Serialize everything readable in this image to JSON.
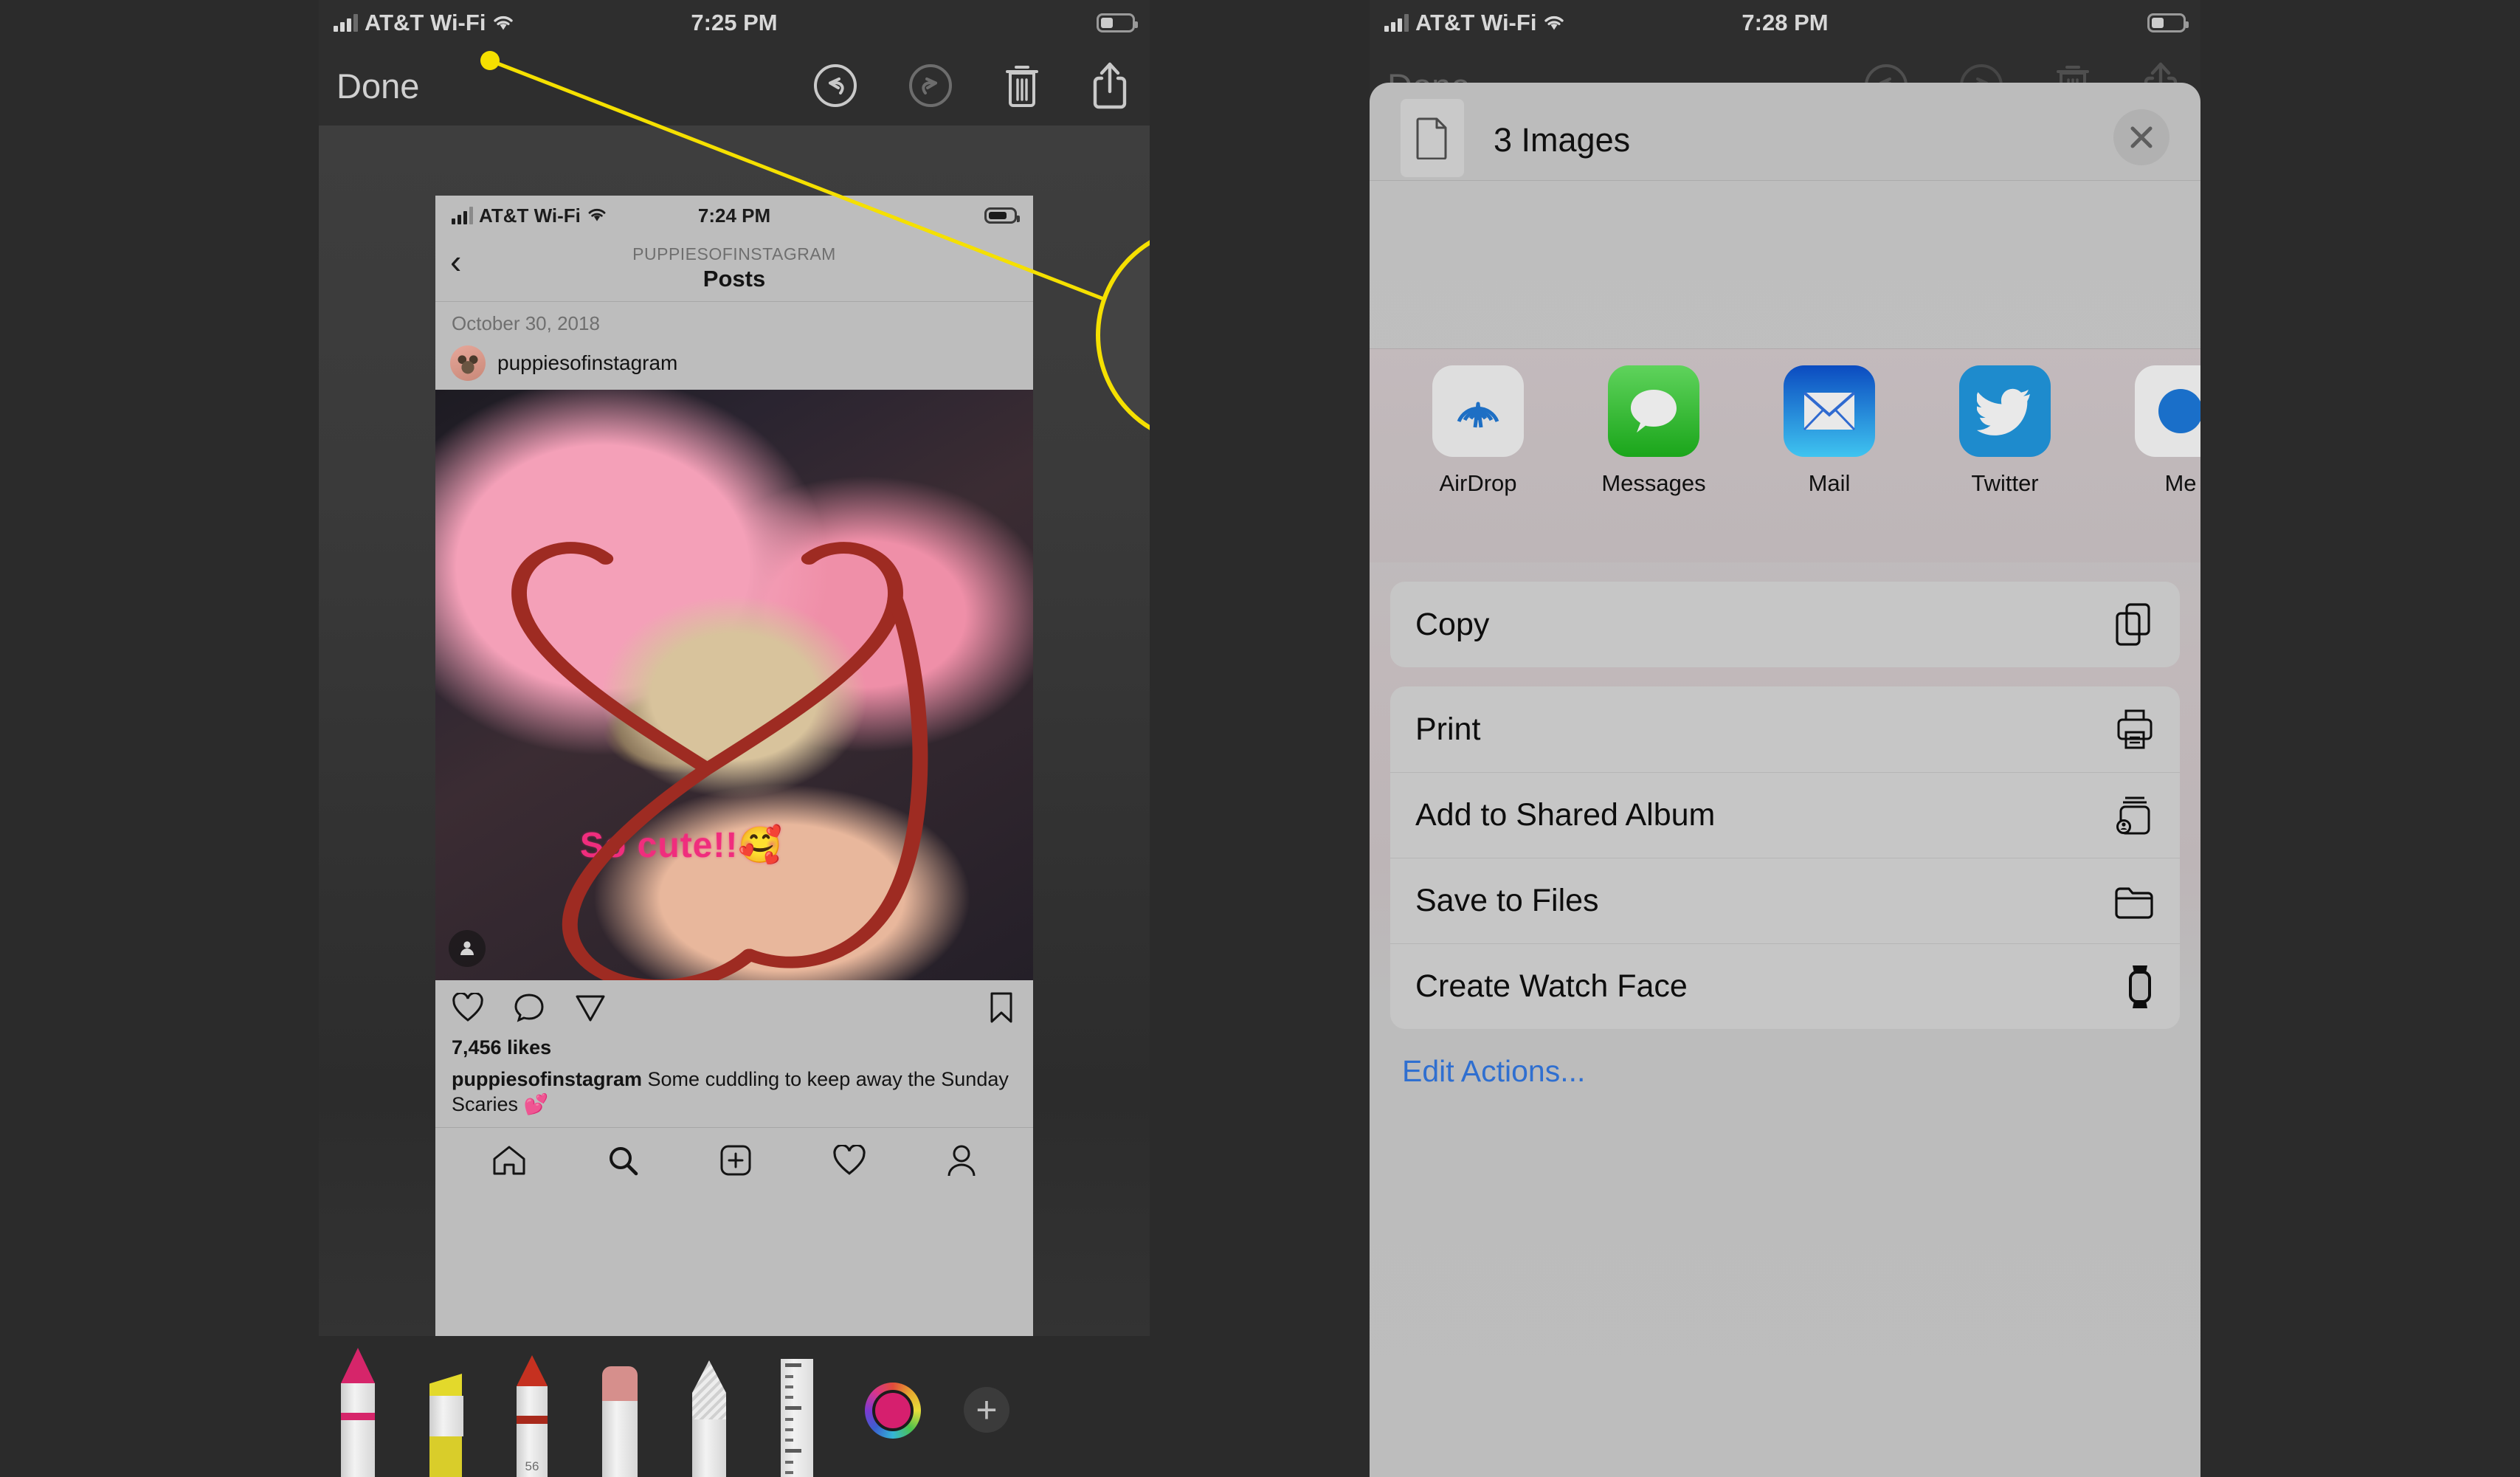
{
  "colors": {
    "highlight_yellow": "#f5e000",
    "sheet_gray": "#bdbdbd",
    "link_blue": "#2f6fd0",
    "markup_red": "#9e2b22",
    "text_pink": "#f02d7d",
    "messages_green": "#3dbb3d",
    "mail_blue": "#1a7fd4",
    "twitter_blue": "#1e8bcd",
    "airdrop_blue": "#1e6fc4"
  },
  "left_panel": {
    "status_bar": {
      "carrier": "AT&T Wi-Fi",
      "time": "7:25 PM",
      "wifi_icon": "wifi-icon",
      "signal_icon": "signal-bars-icon",
      "battery_icon": "battery-icon"
    },
    "markup_toolbar": {
      "done_label": "Done",
      "undo_icon": "undo-icon",
      "redo_icon": "redo-icon",
      "trash_icon": "trash-icon",
      "share_icon": "share-icon"
    },
    "callout": {
      "target_icon": "share-icon",
      "shape": "circle-highlight"
    },
    "screenshot": {
      "status_bar": {
        "carrier": "AT&T Wi-Fi",
        "time": "7:24 PM"
      },
      "nav": {
        "back_icon": "chevron-left-icon",
        "account": "PUPPIESOFINSTAGRAM",
        "title": "Posts"
      },
      "post": {
        "date": "October 30, 2018",
        "username": "puppiesofinstagram",
        "avatar_icon": "avatar",
        "tag_icon": "person-tag-icon",
        "annotation_text": "So cute!!🥰",
        "actions": {
          "like_icon": "heart-icon",
          "comment_icon": "comment-icon",
          "share_icon": "paper-plane-icon",
          "save_icon": "bookmark-icon"
        },
        "likes": "7,456 likes",
        "caption_author": "puppiesofinstagram",
        "caption_text": " Some cuddling to keep away the Sunday Scaries 💕"
      },
      "tabbar": {
        "home_icon": "home-icon",
        "search_icon": "search-icon",
        "add_icon": "add-post-icon",
        "activity_icon": "heart-icon",
        "profile_icon": "profile-icon"
      }
    },
    "markup_tools": {
      "pen_icon": "pen-tool",
      "highlighter_icon": "highlighter-tool",
      "marker_icon": "marker-tool",
      "eraser_icon": "eraser-tool",
      "lasso_icon": "lasso-tool",
      "ruler_icon": "ruler-tool",
      "color_icon": "color-wheel",
      "add_label": "+",
      "marker_number": "56"
    }
  },
  "right_panel": {
    "status_bar": {
      "carrier": "AT&T Wi-Fi",
      "time": "7:28 PM",
      "wifi_icon": "wifi-icon",
      "signal_icon": "signal-bars-icon",
      "battery_icon": "battery-icon"
    },
    "ghost_toolbar": {
      "done_label": "Done",
      "undo_icon": "undo-icon",
      "redo_icon": "redo-icon",
      "trash_icon": "trash-icon",
      "share_icon": "share-icon"
    },
    "share_sheet": {
      "doc_icon": "document-icon",
      "title": "3 Images",
      "close_icon": "close-icon",
      "apps": [
        {
          "label": "AirDrop",
          "icon": "airdrop-icon"
        },
        {
          "label": "Messages",
          "icon": "messages-icon"
        },
        {
          "label": "Mail",
          "icon": "mail-icon"
        },
        {
          "label": "Twitter",
          "icon": "twitter-icon"
        },
        {
          "label": "Me",
          "icon": "more-icon"
        }
      ],
      "actions": [
        {
          "label": "Copy",
          "icon": "copy-icon"
        },
        {
          "label": "Print",
          "icon": "print-icon"
        },
        {
          "label": "Add to Shared Album",
          "icon": "shared-album-icon"
        },
        {
          "label": "Save to Files",
          "icon": "folder-icon"
        },
        {
          "label": "Create Watch Face",
          "icon": "watch-icon"
        }
      ],
      "edit_actions_label": "Edit Actions..."
    }
  }
}
